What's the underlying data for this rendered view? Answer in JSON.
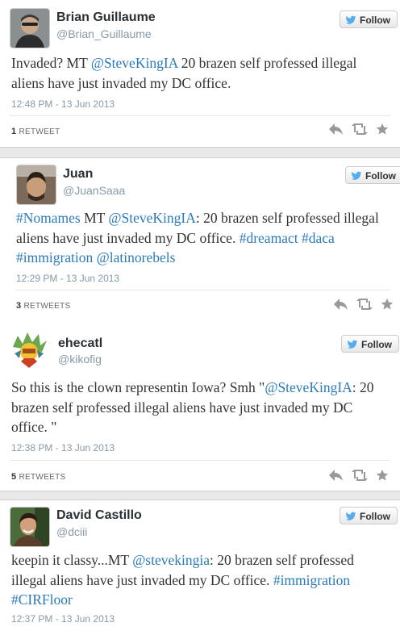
{
  "tweets": [
    {
      "name": "Brian Guillaume",
      "handle": "@Brian_Guillaume",
      "follow_label": "Follow",
      "text_parts": [
        {
          "t": "Invaded? MT ",
          "link": false
        },
        {
          "t": "@SteveKingIA",
          "link": true
        },
        {
          "t": " 20 brazen self professed illegal aliens have just invaded my DC office.",
          "link": false
        }
      ],
      "time": "12:48 PM - 13 Jun 2013",
      "retweet_count": "1",
      "retweet_label": "RETWEET"
    },
    {
      "name": "Juan",
      "handle": "@JuanSaaa",
      "follow_label": "Follow",
      "text_parts": [
        {
          "t": "#Nomames",
          "link": true
        },
        {
          "t": " MT ",
          "link": false
        },
        {
          "t": "@SteveKingIA",
          "link": true
        },
        {
          "t": ": 20 brazen self professed illegal aliens have just invaded my DC office. ",
          "link": false
        },
        {
          "t": "#dreamact",
          "link": true
        },
        {
          "t": " ",
          "link": false
        },
        {
          "t": "#daca",
          "link": true
        },
        {
          "t": " ",
          "link": false
        },
        {
          "t": "#immigration",
          "link": true
        },
        {
          "t": " ",
          "link": false
        },
        {
          "t": "@latinorebels",
          "link": true
        }
      ],
      "time": "12:29 PM - 13 Jun 2013",
      "retweet_count": "3",
      "retweet_label": "RETWEETS"
    },
    {
      "name": "ehecatl",
      "handle": "@kikofig",
      "follow_label": "Follow",
      "text_parts": [
        {
          "t": "So this is the clown representin Iowa? Smh \"",
          "link": false
        },
        {
          "t": "@SteveKingIA",
          "link": true
        },
        {
          "t": ": 20 brazen self professed illegal aliens have just invaded my DC office. \"",
          "link": false
        }
      ],
      "time": "12:38 PM - 13 Jun 2013",
      "retweet_count": "5",
      "retweet_label": "RETWEETS"
    },
    {
      "name": "David Castillo",
      "handle": "@dciii",
      "follow_label": "Follow",
      "text_parts": [
        {
          "t": "keepin it classy...MT ",
          "link": false
        },
        {
          "t": "@stevekingia",
          "link": true
        },
        {
          "t": ": 20 brazen self professed illegal aliens have just invaded my DC office. ",
          "link": false
        },
        {
          "t": "#immigration",
          "link": true
        },
        {
          "t": " ",
          "link": false
        },
        {
          "t": "#CIRFloor",
          "link": true
        }
      ],
      "time": "12:37 PM - 13 Jun 2013",
      "retweet_count": "",
      "retweet_label": ""
    }
  ],
  "colors": {
    "link": "#2b7bb9",
    "twitter_blue": "#55acee",
    "action_gray": "#999999"
  },
  "icons": [
    "twitter-bird-icon",
    "reply-icon",
    "retweet-icon",
    "favorite-icon"
  ]
}
